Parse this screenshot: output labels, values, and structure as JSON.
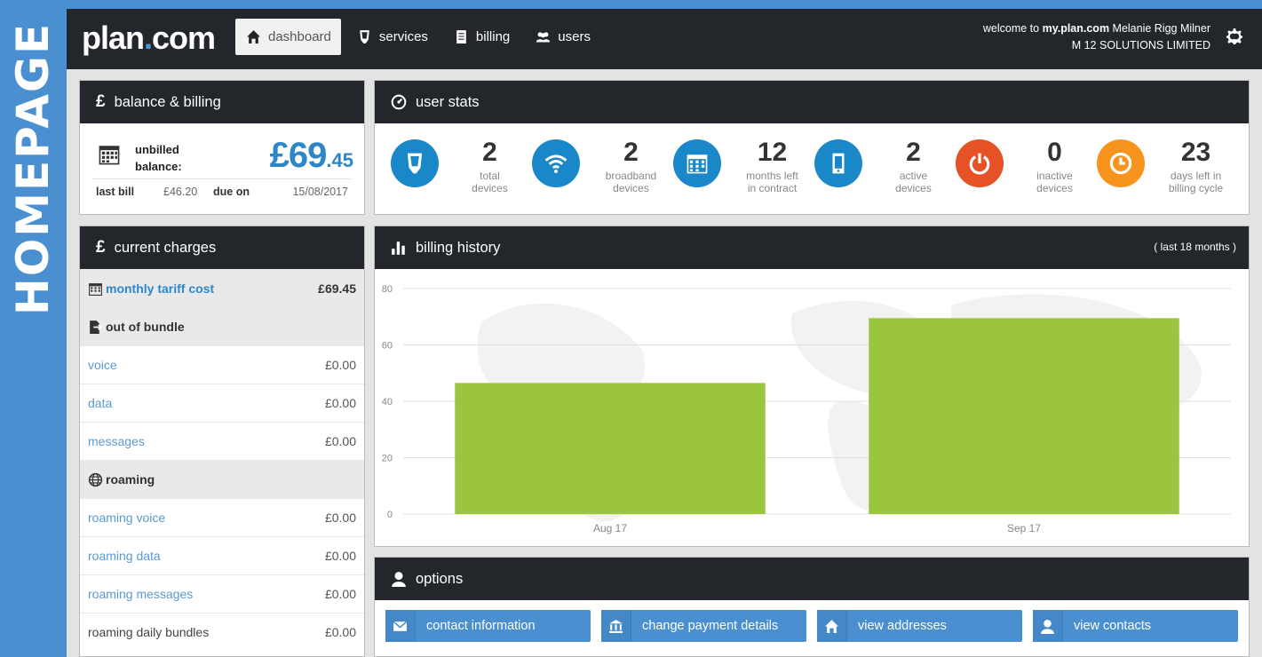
{
  "side_label": "HOMEPAGE",
  "topbar": {
    "logo_main": "plan",
    "logo_dot": ".",
    "logo_tld": "com",
    "nav": [
      {
        "label": "dashboard",
        "icon": "home-icon"
      },
      {
        "label": "services",
        "icon": "phone-icon"
      },
      {
        "label": "billing",
        "icon": "document-icon"
      },
      {
        "label": "users",
        "icon": "users-icon"
      }
    ],
    "welcome_prefix": "welcome to ",
    "welcome_site": "my.plan.com",
    "welcome_user": " Melanie Rigg Milner",
    "company": "M 12 SOLUTIONS LIMITED"
  },
  "balance": {
    "title": "balance & billing",
    "pound": "£",
    "unbilled_label_1": "unbilled",
    "unbilled_label_2": "balance:",
    "amount_main": "£69",
    "amount_cents": ".45",
    "last_bill_label": "last bill",
    "last_bill_value": "£46.20",
    "due_label": "due on",
    "due_value": "15/08/2017"
  },
  "user_stats": {
    "title": "user stats",
    "items": [
      {
        "value": "2",
        "label_1": "total",
        "label_2": "devices",
        "color": "#1a87c9",
        "icon": "phone-icon"
      },
      {
        "value": "2",
        "label_1": "broadband",
        "label_2": "devices",
        "color": "#1a87c9",
        "icon": "wifi-icon"
      },
      {
        "value": "12",
        "label_1": "months left",
        "label_2": "in contract",
        "color": "#1a87c9",
        "icon": "calendar-icon"
      },
      {
        "value": "2",
        "label_1": "active",
        "label_2": "devices",
        "color": "#1a87c9",
        "icon": "mobile-icon"
      },
      {
        "value": "0",
        "label_1": "inactive",
        "label_2": "devices",
        "color": "#e55226",
        "icon": "power-icon"
      },
      {
        "value": "23",
        "label_1": "days left in",
        "label_2": "billing cycle",
        "color": "#f7941d",
        "icon": "clock-icon"
      }
    ]
  },
  "charges": {
    "title": "current charges",
    "pound": "£",
    "tariff_label": "monthly tariff cost",
    "tariff_value": "£69.45",
    "out_of_bundle_label": "out of bundle",
    "oob": [
      {
        "label": "voice",
        "value": "£0.00"
      },
      {
        "label": "data",
        "value": "£0.00"
      },
      {
        "label": "messages",
        "value": "£0.00"
      }
    ],
    "roaming_label": "roaming",
    "roaming": [
      {
        "label": "roaming voice",
        "value": "£0.00"
      },
      {
        "label": "roaming data",
        "value": "£0.00"
      },
      {
        "label": "roaming messages",
        "value": "£0.00"
      },
      {
        "label": "roaming daily bundles",
        "value": "£0.00"
      }
    ]
  },
  "billing_history": {
    "title": "billing history",
    "subtitle": "( last 18 months )"
  },
  "chart_data": {
    "type": "bar",
    "categories": [
      "Aug 17",
      "Sep 17"
    ],
    "values": [
      46.5,
      69.5
    ],
    "ylim": [
      0,
      80
    ],
    "yticks": [
      0,
      20,
      40,
      60,
      80
    ],
    "bar_color": "#9bc43f",
    "grid": true
  },
  "options": {
    "title": "options",
    "buttons": [
      {
        "label": "contact information",
        "icon": "envelope-icon"
      },
      {
        "label": "change payment details",
        "icon": "bank-icon"
      },
      {
        "label": "view addresses",
        "icon": "home-icon"
      },
      {
        "label": "view contacts",
        "icon": "user-icon"
      }
    ]
  }
}
